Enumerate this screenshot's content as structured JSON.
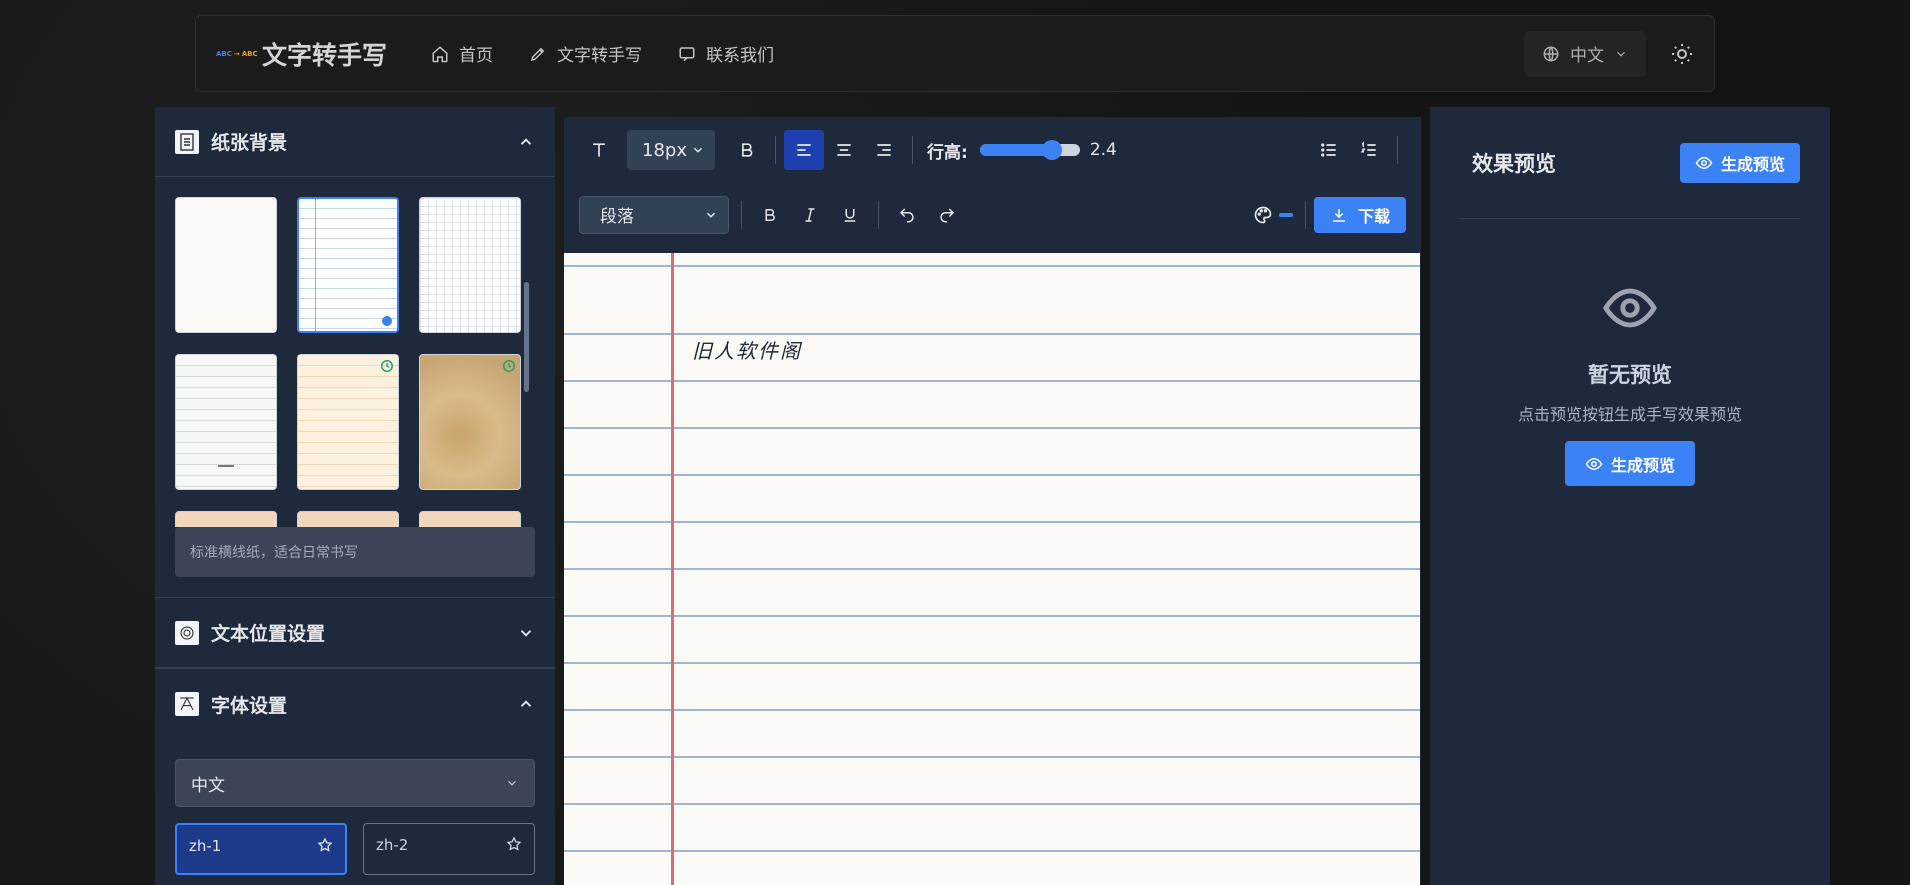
{
  "app": {
    "title": "文字转手写",
    "logo_text_a": "ABC",
    "logo_text_b": "ABC"
  },
  "nav": {
    "items": [
      {
        "label": "首页",
        "icon": "home-icon"
      },
      {
        "label": "文字转手写",
        "icon": "pen-icon"
      },
      {
        "label": "联系我们",
        "icon": "message-icon"
      }
    ],
    "language": "中文",
    "theme_icon": "sun-icon"
  },
  "sidebar": {
    "paper_section": {
      "title": "纸张背景",
      "expanded": true
    },
    "papers": [
      {
        "style": "plain",
        "selected": false,
        "premium": false
      },
      {
        "style": "lined-blue",
        "selected": true,
        "premium": false
      },
      {
        "style": "grid",
        "selected": false,
        "premium": false
      },
      {
        "style": "gray-lined",
        "selected": false,
        "premium": false
      },
      {
        "style": "cream",
        "selected": false,
        "premium": true
      },
      {
        "style": "old",
        "selected": false,
        "premium": true
      },
      {
        "style": "peach",
        "selected": false,
        "premium": true
      },
      {
        "style": "peach",
        "selected": false,
        "premium": true
      },
      {
        "style": "peach",
        "selected": false,
        "premium": true
      }
    ],
    "paper_description": "标准横线纸，适合日常书写",
    "text_position_section": {
      "title": "文本位置设置",
      "expanded": false
    },
    "font_section": {
      "title": "字体设置",
      "expanded": true
    },
    "font_language": "中文",
    "fonts": [
      {
        "name": "zh-1",
        "active": true
      },
      {
        "name": "zh-2",
        "active": false
      }
    ]
  },
  "editor": {
    "font_size": "18px",
    "bold_label": "B",
    "line_height_label": "行高:",
    "line_height_value": "2.4",
    "line_height_fraction": 0.72,
    "paragraph_select": "段落",
    "download_label": "下载",
    "text_color": "#3b82f6",
    "content": "旧人软件阁"
  },
  "preview": {
    "title": "效果预览",
    "generate_label": "生成预览",
    "empty_title": "暂无预览",
    "empty_sub": "点击预览按钮生成手写效果预览",
    "empty_button_label": "生成预览"
  },
  "colors": {
    "accent": "#3b82f6",
    "panel": "#1e293b",
    "margin_line": "#e06a78"
  }
}
